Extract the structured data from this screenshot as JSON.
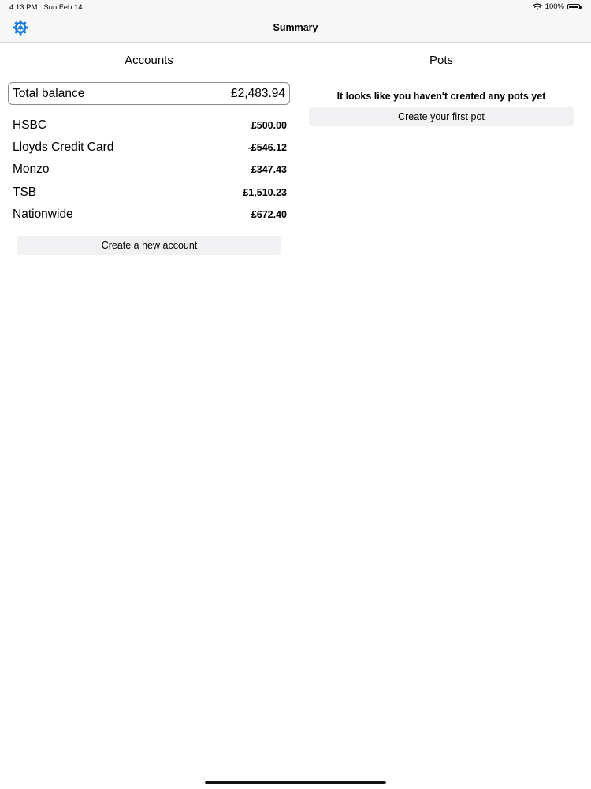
{
  "status_bar": {
    "time": "4:13 PM",
    "date": "Sun Feb 14",
    "battery_text": "100%",
    "battery_level": 1.0
  },
  "nav": {
    "title": "Summary",
    "settings_icon": "gear-icon"
  },
  "accounts": {
    "title": "Accounts",
    "total_label": "Total balance",
    "total_value": "£2,483.94",
    "items": [
      {
        "name": "HSBC",
        "balance": "£500.00"
      },
      {
        "name": "Lloyds Credit Card",
        "balance": "-£546.12"
      },
      {
        "name": "Monzo",
        "balance": "£347.43"
      },
      {
        "name": "TSB",
        "balance": "£1,510.23"
      },
      {
        "name": "Nationwide",
        "balance": "£672.40"
      }
    ],
    "create_label": "Create a new account"
  },
  "pots": {
    "title": "Pots",
    "empty_message": "It looks like you haven't created any pots yet",
    "create_label": "Create your first pot"
  },
  "colors": {
    "accent": "#1a7fd9",
    "bar_background": "#f7f7f8",
    "button_background": "#f1f1f3"
  }
}
